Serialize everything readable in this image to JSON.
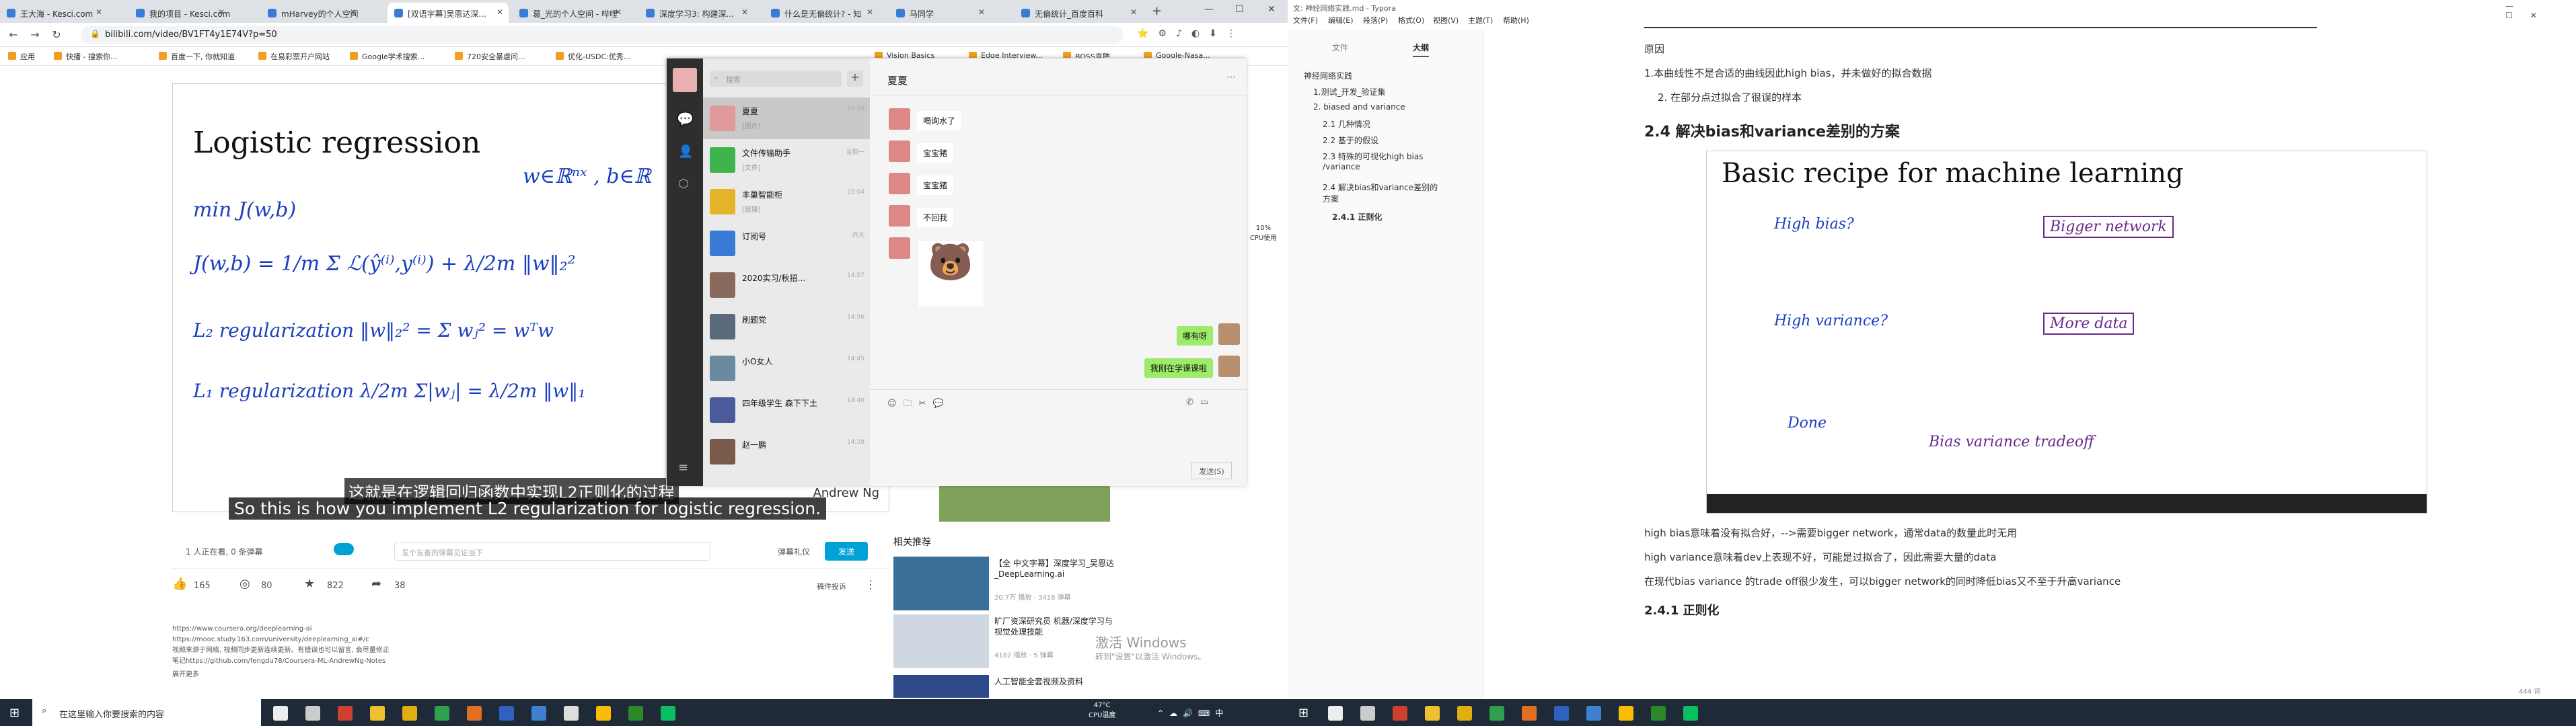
{
  "left_screen": {
    "tabs": [
      "王大海 - Kesci.com",
      "我的项目 - Kesci.com",
      "mHarvey的个人空间",
      "[双语字幕]吴恩达深...",
      "葛_光的个人空间 - 哔哩",
      "深度学习3: 构建深...",
      "什么是无偏统计? - 知",
      "马同学",
      "无偏统计_百度百科"
    ],
    "url": "bilibili.com/video/BV1FT4y1E74V?p=50",
    "bookmarks": [
      "应用",
      "快播 - 搜索你...",
      "百度一下, 你就知道",
      "在易彩票开户网站",
      "Google学术搜索...",
      "720安全暴虐问...",
      "优化-USDC:优秀...",
      "Vision Basics",
      "Edge Interview...",
      "BOSS直聘",
      "Google-Nasa..."
    ],
    "video": {
      "title": "Logistic regression",
      "sub_cn": "这就是在逻辑回归函数中实现L2正则化的过程",
      "sub_en": "So this is how you implement L2 regularization for logistic regression.",
      "watermark": "Andrew Ng",
      "viewers": "1 人正在看, 0 条弹幕",
      "danmaku_placeholder": "发个友善的弹幕见证当下",
      "danmaku_link": "弹幕礼仪",
      "send": "发送"
    },
    "stats": {
      "like": "165",
      "coin": "80",
      "fav": "822",
      "share": "38",
      "report": "稿件投诉"
    },
    "desc": [
      "https://www.coursera.org/deeplearning-ai",
      "https://mooc.study.163.com/university/deeplearning_ai#/c",
      "视频来源于网络, 视频同步更新连续更新。有错误也可以留言, 会尽量修正",
      "笔记https://github.com/fengdu78/Coursera-ML-AndrewNg-Notes"
    ],
    "expand": "展开更多",
    "related_title": "相关推荐",
    "related": [
      {
        "title": "【全 中文字幕】深度学习_吴恩达_DeepLearning.ai",
        "meta": "20.7万 播放 · 3418 弹幕"
      },
      {
        "title": "旷厂资深研究员 机器/深度学习与视觉处理技能",
        "meta": "4182 播放 · 5 弹幕"
      },
      {
        "title": "人工智能全套视频及资料",
        "meta": ""
      }
    ],
    "activate": "激活 Windows",
    "activate_sub": "转到\"设置\"以激活 Windows。",
    "wechat": {
      "search": "搜索",
      "chat_title": "夏夏",
      "contacts": [
        {
          "name": "夏夏",
          "preview": "[图片]",
          "time": "15:58"
        },
        {
          "name": "文件传输助手",
          "preview": "[文件]",
          "time": "星期一"
        },
        {
          "name": "丰巢智能柜",
          "preview": "[链接]",
          "time": "15:04"
        },
        {
          "name": "订阅号",
          "preview": "",
          "time": "昨天"
        },
        {
          "name": "2020实习/秋招...",
          "preview": "",
          "time": "14:57"
        },
        {
          "name": "刷题党",
          "preview": "",
          "time": "14:56"
        },
        {
          "name": "小O女人",
          "preview": "",
          "time": "14:45"
        },
        {
          "name": "四年级学生 森下下土",
          "preview": "",
          "time": "14:40"
        },
        {
          "name": "赵一鹏",
          "preview": "",
          "time": "14:28"
        }
      ],
      "messages": [
        {
          "text": "喝询水了",
          "me": false
        },
        {
          "text": "宝宝猪",
          "me": false
        },
        {
          "text": "宝宝猪",
          "me": false
        },
        {
          "text": "不回我",
          "me": false
        },
        {
          "text": "哪有呀",
          "me": true
        },
        {
          "text": "我刚在学课课啦",
          "me": true
        }
      ],
      "send": "发送(S)"
    },
    "cpu": {
      "percent": "49",
      "label": "CPU使用",
      "value": "10%"
    },
    "taskbar": {
      "search": "在这里输入你要搜索的内容",
      "temp": "47°C",
      "temp_label": "CPU温度"
    }
  },
  "right_screen": {
    "window_title": "文: 神经网络实践.md - Typora",
    "menu": [
      "文件(F)",
      "编辑(E)",
      "段落(P)",
      "格式(O)",
      "视图(V)",
      "主题(T)",
      "帮助(H)"
    ],
    "side_tabs": [
      "文件",
      "大纲"
    ],
    "outline": [
      "神经网络实践",
      "1.测试_开发_验证集",
      "2. biased and variance",
      "2.1 几种情况",
      "2.2 基于的假设",
      "2.3 特殊的可视化high bias /variance",
      "2.4 解决bias和variance差别的方案",
      "2.4.1 正则化"
    ],
    "content": {
      "p_reason": "原因",
      "p1": "1.本曲线性不是合适的曲线因此high bias，并未做好的拟合数据",
      "p2": "2. 在部分点过拟合了很误的样本",
      "h2": "2.4 解决bias和variance差别的方案",
      "slide_title": "Basic recipe for machine learning",
      "p3": "high bias意味着没有拟合好，-->需要bigger network，通常data的数量此时无用",
      "p4": "high variance意味着dev上表现不好，可能是过拟合了，因此需要大量的data",
      "p5": "在现代bias variance 的trade off很少发生，可以bigger network的同时降低bias又不至于升高variance",
      "h3": "2.4.1  正则化",
      "wordcount": "444 词"
    }
  }
}
